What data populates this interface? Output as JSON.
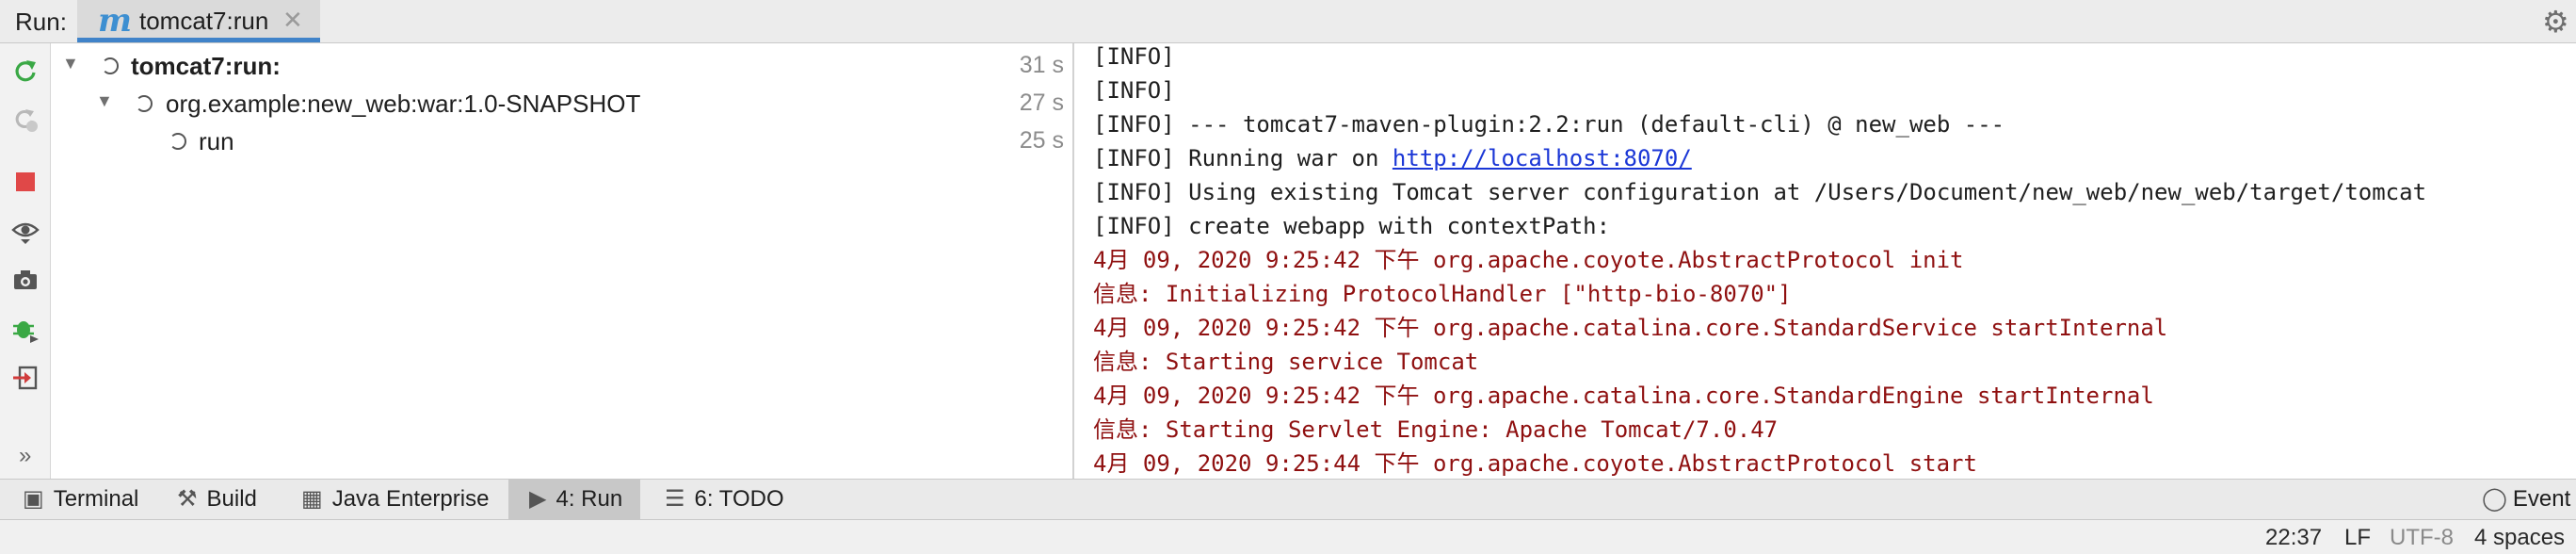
{
  "header": {
    "run_label": "Run:",
    "tab_title": "tomcat7:run",
    "tab_icon": "m"
  },
  "tree": {
    "nodes": [
      {
        "label": "tomcat7:run:",
        "time": "31 s",
        "bold": true
      },
      {
        "label": "org.example:new_web:war:1.0-SNAPSHOT",
        "time": "27 s"
      },
      {
        "label": "run",
        "time": "25 s"
      }
    ]
  },
  "console": {
    "lines": [
      {
        "kind": "info",
        "text": "[INFO]"
      },
      {
        "kind": "info",
        "text": "[INFO]"
      },
      {
        "kind": "info",
        "text": "[INFO] --- tomcat7-maven-plugin:2.2:run (default-cli) @ new_web ---"
      },
      {
        "kind": "info",
        "text": "[INFO] Running war on ",
        "link": "http://localhost:8070/"
      },
      {
        "kind": "info",
        "text": "[INFO] Using existing Tomcat server configuration at /Users/Document/new_web/new_web/target/tomcat"
      },
      {
        "kind": "info",
        "text": "[INFO] create webapp with contextPath:"
      },
      {
        "kind": "err",
        "text": "4月 09, 2020 9:25:42 下午 org.apache.coyote.AbstractProtocol init"
      },
      {
        "kind": "err",
        "text": "信息: Initializing ProtocolHandler [\"http-bio-8070\"]"
      },
      {
        "kind": "err",
        "text": "4月 09, 2020 9:25:42 下午 org.apache.catalina.core.StandardService startInternal"
      },
      {
        "kind": "err",
        "text": "信息: Starting service Tomcat"
      },
      {
        "kind": "err",
        "text": "4月 09, 2020 9:25:42 下午 org.apache.catalina.core.StandardEngine startInternal"
      },
      {
        "kind": "err",
        "text": "信息: Starting Servlet Engine: Apache Tomcat/7.0.47"
      },
      {
        "kind": "err",
        "text": "4月 09, 2020 9:25:44 下午 org.apache.coyote.AbstractProtocol start"
      }
    ]
  },
  "strip": {
    "terminal": "Terminal",
    "build": "Build",
    "java_enterprise": "Java Enterprise",
    "run": "4: Run",
    "todo": "6: TODO",
    "event": "Event"
  },
  "status": {
    "position": "22:37",
    "line_sep": "LF",
    "encoding": "UTF-8",
    "indent": "4 spaces"
  },
  "colors": {
    "accent": "#4083c9",
    "error_text": "#8f1010",
    "link": "#1a36d6",
    "rerun_green": "#3aa845",
    "stop_red": "#e04848"
  }
}
